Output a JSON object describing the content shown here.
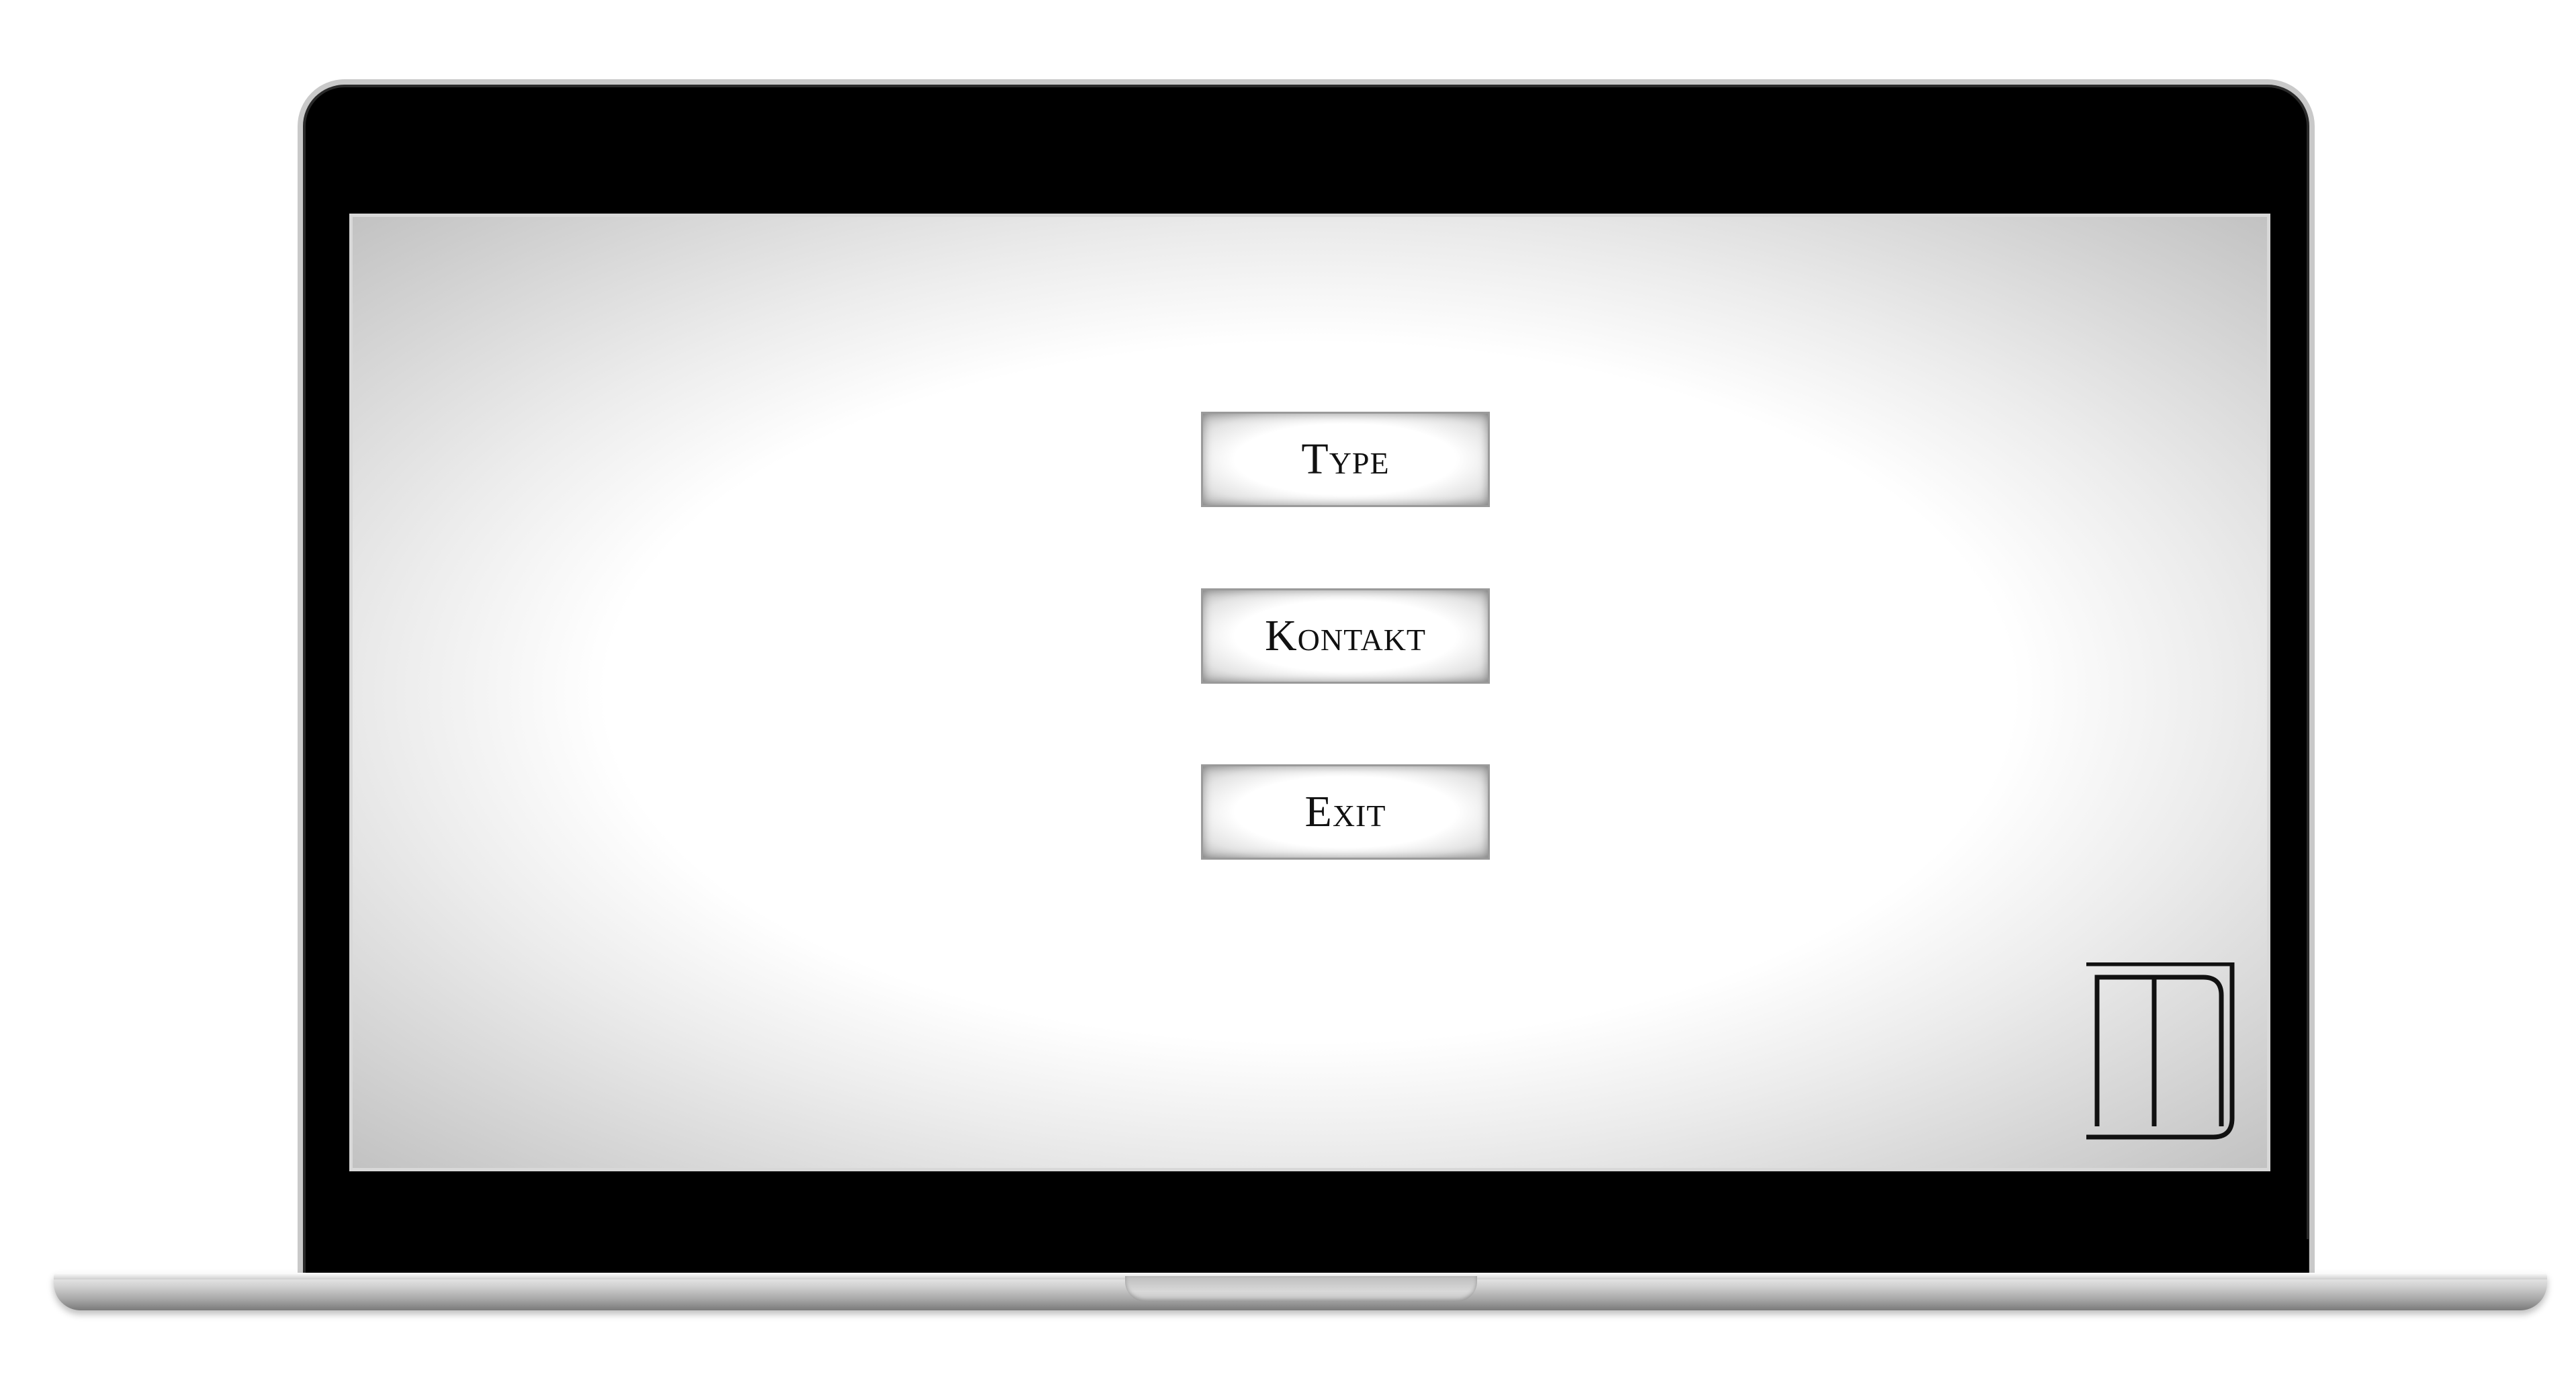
{
  "menu": {
    "items": [
      {
        "label": "Type"
      },
      {
        "label": "Kontakt"
      },
      {
        "label": "Exit"
      }
    ]
  },
  "logo": {
    "icon": "monogram-logo-icon"
  },
  "colors": {
    "bezel": "#000000",
    "screen_center": "#ffffff",
    "screen_edge": "#c2c2c2",
    "button_border": "#9a9a9a",
    "text": "#111111"
  }
}
